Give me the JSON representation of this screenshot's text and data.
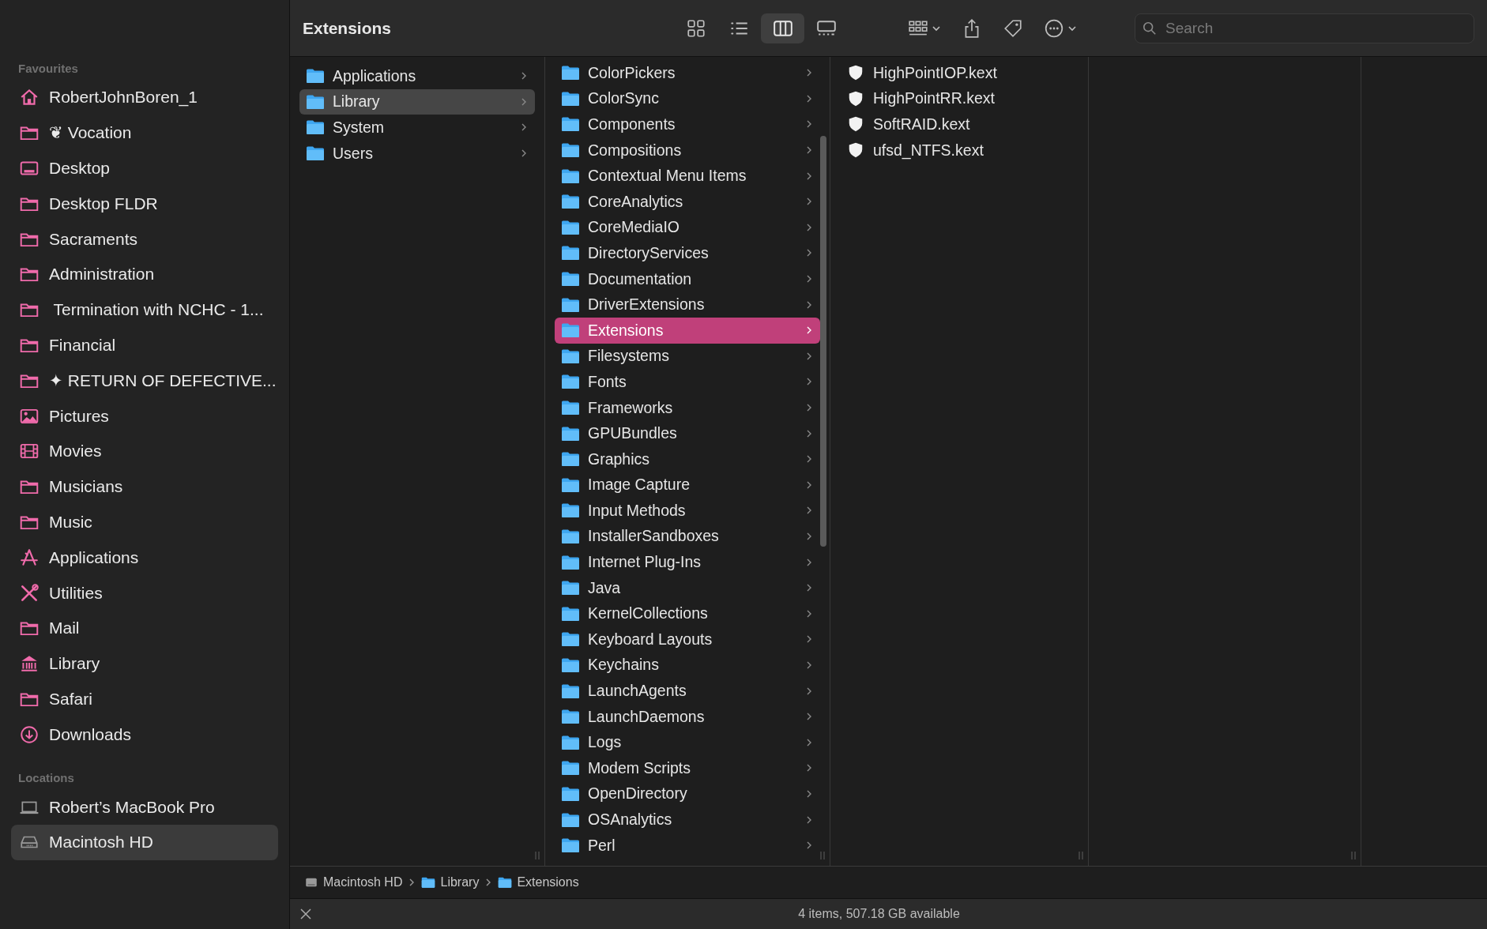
{
  "window": {
    "title": "Extensions"
  },
  "toolbar": {
    "view_buttons": [
      {
        "kind": "icons",
        "selected": false
      },
      {
        "kind": "list",
        "selected": false
      },
      {
        "kind": "columns",
        "selected": true
      },
      {
        "kind": "gallery",
        "selected": false
      }
    ],
    "search": {
      "placeholder": "Search"
    }
  },
  "sidebar": {
    "sections": [
      {
        "heading": "Favourites",
        "items": [
          {
            "label": "RobertJohnBoren_1",
            "kind": "home",
            "selected": false
          },
          {
            "label": "❦ Vocation",
            "kind": "folder",
            "selected": false
          },
          {
            "label": "Desktop",
            "kind": "desktop",
            "selected": false
          },
          {
            "label": "Desktop FLDR",
            "kind": "folder",
            "selected": false
          },
          {
            "label": "Sacraments",
            "kind": "folder",
            "selected": false
          },
          {
            "label": "Administration",
            "kind": "folder",
            "selected": false
          },
          {
            "label": " Termination with NCHC - 1...",
            "kind": "folder",
            "selected": false
          },
          {
            "label": "Financial",
            "kind": "folder",
            "selected": false
          },
          {
            "label": "✦ RETURN OF DEFECTIVE...",
            "kind": "folder",
            "selected": false
          },
          {
            "label": "Pictures",
            "kind": "pictures",
            "selected": false
          },
          {
            "label": "Movies",
            "kind": "movies",
            "selected": false
          },
          {
            "label": "Musicians",
            "kind": "folder",
            "selected": false
          },
          {
            "label": "Music",
            "kind": "folder",
            "selected": false
          },
          {
            "label": "Applications",
            "kind": "apps",
            "selected": false
          },
          {
            "label": "Utilities",
            "kind": "utilities",
            "selected": false
          },
          {
            "label": "Mail",
            "kind": "folder",
            "selected": false
          },
          {
            "label": "Library",
            "kind": "library",
            "selected": false
          },
          {
            "label": "Safari",
            "kind": "folder",
            "selected": false
          },
          {
            "label": "Downloads",
            "kind": "downloads",
            "selected": false
          }
        ]
      },
      {
        "heading": "Locations",
        "items": [
          {
            "label": "Robert’s MacBook Pro",
            "kind": "laptop",
            "selected": false
          },
          {
            "label": "Macintosh HD",
            "kind": "drive",
            "selected": true
          }
        ]
      }
    ]
  },
  "columns": [
    {
      "focused": false,
      "items": [
        {
          "label": "Applications",
          "kind": "folder",
          "selected": false
        },
        {
          "label": "Library",
          "kind": "folder",
          "selected": true
        },
        {
          "label": "System",
          "kind": "folder",
          "selected": false
        },
        {
          "label": "Users",
          "kind": "folder",
          "selected": false
        }
      ]
    },
    {
      "focused": true,
      "items": [
        {
          "label": "ColorPickers",
          "kind": "folder",
          "selected": false
        },
        {
          "label": "ColorSync",
          "kind": "folder",
          "selected": false
        },
        {
          "label": "Components",
          "kind": "folder",
          "selected": false
        },
        {
          "label": "Compositions",
          "kind": "folder",
          "selected": false
        },
        {
          "label": "Contextual Menu Items",
          "kind": "folder",
          "selected": false
        },
        {
          "label": "CoreAnalytics",
          "kind": "folder",
          "selected": false
        },
        {
          "label": "CoreMediaIO",
          "kind": "folder",
          "selected": false
        },
        {
          "label": "DirectoryServices",
          "kind": "folder",
          "selected": false
        },
        {
          "label": "Documentation",
          "kind": "folder",
          "selected": false
        },
        {
          "label": "DriverExtensions",
          "kind": "folder",
          "selected": false
        },
        {
          "label": "Extensions",
          "kind": "folder",
          "selected": true
        },
        {
          "label": "Filesystems",
          "kind": "folder",
          "selected": false
        },
        {
          "label": "Fonts",
          "kind": "folder",
          "selected": false
        },
        {
          "label": "Frameworks",
          "kind": "folder",
          "selected": false
        },
        {
          "label": "GPUBundles",
          "kind": "folder",
          "selected": false
        },
        {
          "label": "Graphics",
          "kind": "folder",
          "selected": false
        },
        {
          "label": "Image Capture",
          "kind": "folder",
          "selected": false
        },
        {
          "label": "Input Methods",
          "kind": "folder",
          "selected": false
        },
        {
          "label": "InstallerSandboxes",
          "kind": "folder",
          "selected": false
        },
        {
          "label": "Internet Plug-Ins",
          "kind": "folder",
          "selected": false
        },
        {
          "label": "Java",
          "kind": "folder",
          "selected": false
        },
        {
          "label": "KernelCollections",
          "kind": "folder",
          "selected": false
        },
        {
          "label": "Keyboard Layouts",
          "kind": "folder",
          "selected": false
        },
        {
          "label": "Keychains",
          "kind": "folder",
          "selected": false
        },
        {
          "label": "LaunchAgents",
          "kind": "folder",
          "selected": false
        },
        {
          "label": "LaunchDaemons",
          "kind": "folder",
          "selected": false
        },
        {
          "label": "Logs",
          "kind": "folder",
          "selected": false
        },
        {
          "label": "Modem Scripts",
          "kind": "folder",
          "selected": false
        },
        {
          "label": "OpenDirectory",
          "kind": "folder",
          "selected": false
        },
        {
          "label": "OSAnalytics",
          "kind": "folder",
          "selected": false
        },
        {
          "label": "Perl",
          "kind": "folder",
          "selected": false
        }
      ]
    },
    {
      "items": [
        {
          "label": "HighPointIOP.kext",
          "kind": "kext",
          "selected": false
        },
        {
          "label": "HighPointRR.kext",
          "kind": "kext",
          "selected": false
        },
        {
          "label": "SoftRAID.kext",
          "kind": "kext",
          "selected": false
        },
        {
          "label": "ufsd_NTFS.kext",
          "kind": "kext",
          "selected": false
        }
      ]
    }
  ],
  "path_bar": [
    {
      "label": "Macintosh HD",
      "kind": "drive"
    },
    {
      "label": "Library",
      "kind": "folder"
    },
    {
      "label": "Extensions",
      "kind": "folder"
    }
  ],
  "status_bar": {
    "text": "4 items, 507.18 GB available"
  }
}
